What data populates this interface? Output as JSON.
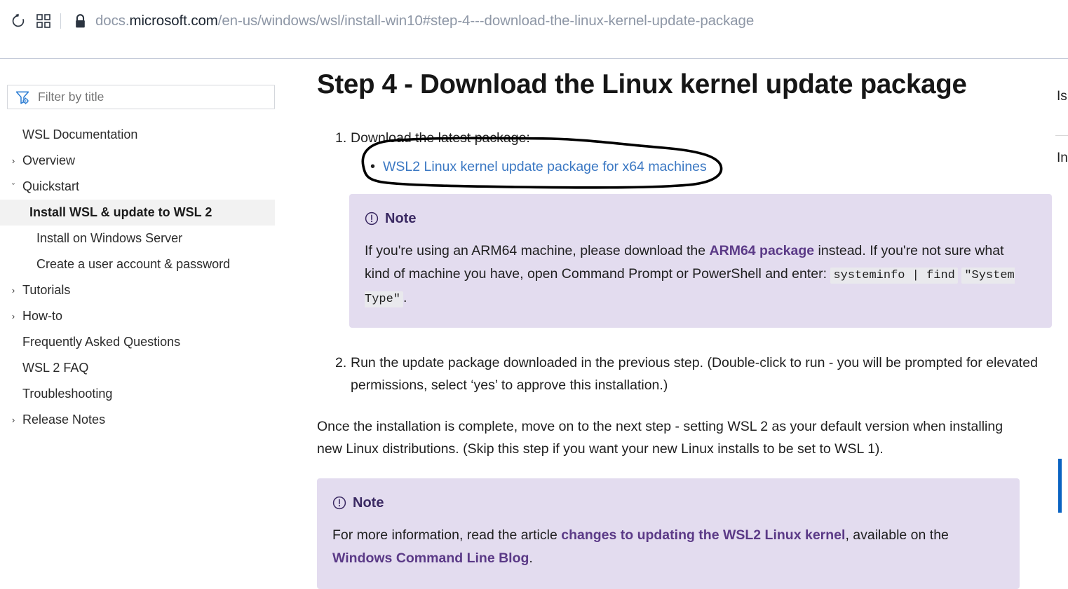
{
  "browser": {
    "reload_label": "Reload",
    "apps_label": "App launcher",
    "lock_label": "Secure connection",
    "url": {
      "prefix": "docs.",
      "domain": "microsoft.com",
      "path": "/en-us/windows/wsl/install-win10#step-4---download-the-linux-kernel-update-package"
    }
  },
  "sidebar": {
    "filter": {
      "placeholder": "Filter by title",
      "value": "",
      "icon": "filter-icon"
    },
    "items": [
      {
        "label": "WSL Documentation",
        "caret": "",
        "level": 0,
        "active": false
      },
      {
        "label": "Overview",
        "caret": "›",
        "level": 0,
        "active": false
      },
      {
        "label": "Quickstart",
        "caret": "ˇ",
        "level": 0,
        "active": false
      },
      {
        "label": "Install WSL & update to WSL 2",
        "caret": "",
        "level": 1,
        "active": true
      },
      {
        "label": "Install on Windows Server",
        "caret": "",
        "level": 1,
        "active": false
      },
      {
        "label": "Create a user account & password",
        "caret": "",
        "level": 1,
        "active": false
      },
      {
        "label": "Tutorials",
        "caret": "›",
        "level": 0,
        "active": false
      },
      {
        "label": "How-to",
        "caret": "›",
        "level": 0,
        "active": false
      },
      {
        "label": "Frequently Asked Questions",
        "caret": "",
        "level": 0,
        "active": false
      },
      {
        "label": "WSL 2 FAQ",
        "caret": "",
        "level": 0,
        "active": false
      },
      {
        "label": "Troubleshooting",
        "caret": "",
        "level": 0,
        "active": false
      },
      {
        "label": "Release Notes",
        "caret": "›",
        "level": 0,
        "active": false
      }
    ]
  },
  "main": {
    "title": "Step 4 - Download the Linux kernel update package",
    "step1": {
      "text": "Download the latest package:",
      "link": "WSL2 Linux kernel update package for x64 machines"
    },
    "note1": {
      "header": "Note",
      "text_before_link": "If you're using an ARM64 machine, please download the ",
      "link": "ARM64 package",
      "text_after_link": " instead. If you're not sure what kind of machine you have, open Command Prompt or PowerShell and enter: ",
      "code1": "systeminfo | find",
      "code2": "\"System Type\"",
      "text_end": "."
    },
    "step2": {
      "text": "Run the update package downloaded in the previous step. (Double-click to run - you will be prompted for elevated permissions, select ‘yes’ to approve this installation.)"
    },
    "paragraph": "Once the installation is complete, move on to the next step - setting WSL 2 as your default version when installing new Linux distributions. (Skip this step if you want your new Linux installs to be set to WSL 1).",
    "note2": {
      "header": "Note",
      "text_before_link": "For more information, read the article ",
      "link1": "changes to updating the WSL2 Linux kernel",
      "text_middle": ", available on the ",
      "link2": "Windows Command Line Blog",
      "text_end": "."
    }
  },
  "right_toc": {
    "item1": "Is",
    "item2": "In"
  },
  "colors": {
    "link_blue": "#3b78c3",
    "note_background": "#e3dcef",
    "note_purple": "#3b2a63",
    "note_link_purple": "#5b3a87",
    "accent_blue": "#0a63c2",
    "active_nav_background": "#f2f2f2",
    "annotation_black": "#000000"
  }
}
